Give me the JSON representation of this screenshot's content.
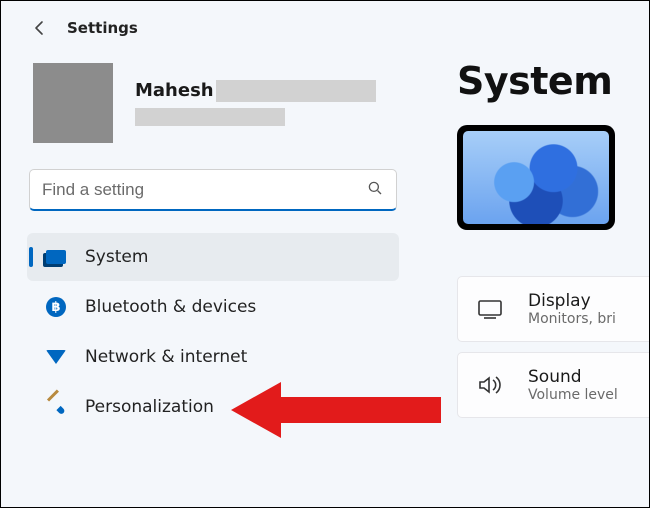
{
  "topbar": {
    "title": "Settings"
  },
  "account": {
    "name": "Mahesh"
  },
  "search": {
    "placeholder": "Find a setting"
  },
  "nav": {
    "items": [
      {
        "label": "System",
        "icon": "system-icon",
        "selected": true
      },
      {
        "label": "Bluetooth & devices",
        "icon": "bluetooth-icon",
        "selected": false
      },
      {
        "label": "Network & internet",
        "icon": "wifi-icon",
        "selected": false
      },
      {
        "label": "Personalization",
        "icon": "brush-icon",
        "selected": false
      }
    ]
  },
  "page": {
    "title": "System",
    "tiles": [
      {
        "title": "Display",
        "subtitle": "Monitors, bri",
        "icon": "display-icon"
      },
      {
        "title": "Sound",
        "subtitle": "Volume level",
        "icon": "sound-icon"
      }
    ]
  },
  "colors": {
    "accent": "#0067c0"
  }
}
